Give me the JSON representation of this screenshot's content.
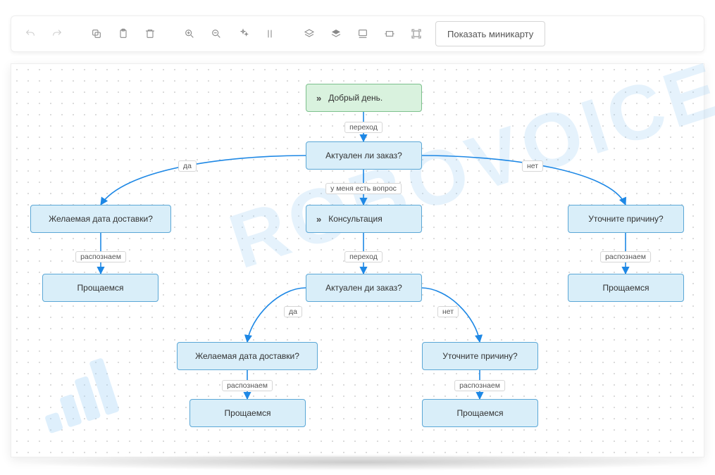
{
  "toolbar": {
    "minimap_label": "Показать миникарту",
    "icons": [
      "undo-icon",
      "redo-icon",
      "copy-icon",
      "paste-icon",
      "delete-icon",
      "zoom-in-icon",
      "zoom-out-icon",
      "magic-icon",
      "bar-icon",
      "layers-front-icon",
      "layers-back-icon",
      "wrap-icon",
      "fit-width-icon",
      "fit-all-icon"
    ]
  },
  "watermark_text": "ROBOVOICE",
  "edge_color": "#1e88e5",
  "nodes": {
    "start": {
      "label": "Добрый день."
    },
    "q_actual": {
      "label": "Актуален ли заказ?"
    },
    "date_left": {
      "label": "Желаемая дата доставки?"
    },
    "bye_left": {
      "label": "Прощаемся"
    },
    "consult": {
      "label": "Консультация"
    },
    "q_actual_mid": {
      "label": "Актуален ди заказ?"
    },
    "date_mid": {
      "label": "Желаемая дата доставки?"
    },
    "bye_mid_l": {
      "label": "Прощаемся"
    },
    "reason_mid": {
      "label": "Уточните причину?"
    },
    "bye_mid_r": {
      "label": "Прощаемся"
    },
    "reason_right": {
      "label": "Уточните причину?"
    },
    "bye_right": {
      "label": "Прощаемся"
    }
  },
  "edge_labels": {
    "start_to_q": "переход",
    "q_yes": "да",
    "q_no": "нет",
    "q_question": "у меня есть вопрос",
    "date_left_rec": "распознаем",
    "consult_trans": "переход",
    "mid_yes": "да",
    "mid_no": "нет",
    "date_mid_rec": "распознаем",
    "reason_mid_rec": "распознаем",
    "reason_right_rec": "распознаем"
  }
}
